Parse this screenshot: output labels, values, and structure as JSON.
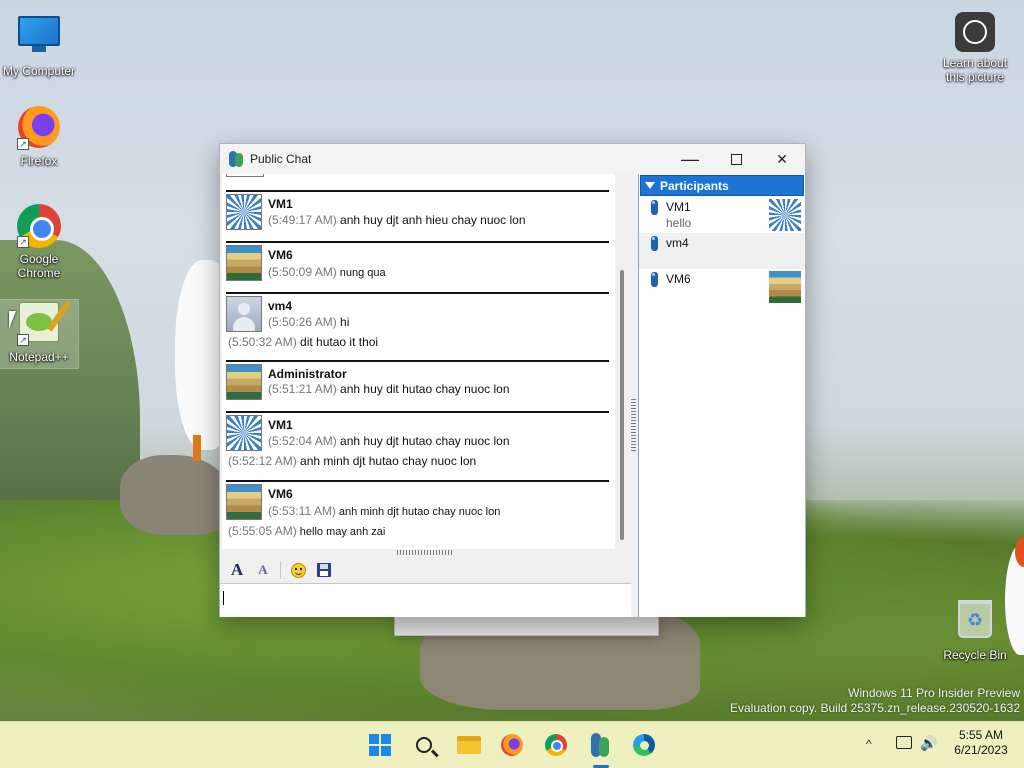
{
  "desktop": {
    "icons": [
      {
        "label": "My Computer",
        "icon": "computer-icon"
      },
      {
        "label": "Firefox",
        "icon": "firefox-icon"
      },
      {
        "label": "Google Chrome",
        "icon": "chrome-icon"
      },
      {
        "label": "Notepad++",
        "icon": "notepad-plus-plus-icon"
      },
      {
        "label": "Recycle Bin",
        "icon": "recycle-bin-icon"
      },
      {
        "label": "Learn about this picture",
        "icon": "learn-picture-icon"
      }
    ],
    "watermark": {
      "line1": "Windows 11 Pro Insider Preview",
      "line2": "Evaluation copy. Build 25375.zn_release.230520-1632"
    }
  },
  "window": {
    "title": "Public Chat",
    "controls": {
      "minimize": "—",
      "close": "✕"
    },
    "messages": [
      {
        "sender": "VM1",
        "avatar": "pinwheel",
        "lines": [
          {
            "time": "(5:49:17 AM)",
            "text": "anh huy djt anh hieu chay nuoc lon"
          }
        ]
      },
      {
        "sender": "VM6",
        "avatar": "stairs",
        "lines": [
          {
            "time": "(5:50:09 AM)",
            "text": "nung qua"
          }
        ]
      },
      {
        "sender": "vm4",
        "avatar": "default-person",
        "lines": [
          {
            "time": "(5:50:26 AM)",
            "text": "hi"
          },
          {
            "time": "(5:50:32 AM)",
            "text": "dit hutao it thoi"
          }
        ]
      },
      {
        "sender": "Administrator",
        "avatar": "stairs",
        "lines": [
          {
            "time": "(5:51:21 AM)",
            "text": "anh huy dit hutao chay nuoc lon"
          }
        ]
      },
      {
        "sender": "VM1",
        "avatar": "pinwheel",
        "lines": [
          {
            "time": "(5:52:04 AM)",
            "text": "anh huy djt hutao chay nuoc lon"
          },
          {
            "time": "(5:52:12 AM)",
            "text": "anh minh djt hutao chay nuoc lon"
          }
        ]
      },
      {
        "sender": "VM6",
        "avatar": "stairs",
        "lines": [
          {
            "time": "(5:53:11 AM)",
            "text": "anh minh djt hutao chay nuoc lon"
          },
          {
            "time": "(5:55:05 AM)",
            "text": "hello may anh zai"
          }
        ]
      }
    ],
    "toolbar": {
      "font_glyph": "A",
      "font_color_glyph": "A",
      "items": [
        "font-icon",
        "font-color-icon",
        "smiley-icon",
        "save-icon"
      ]
    },
    "input": {
      "value": ""
    },
    "participants": {
      "header": "Participants",
      "items": [
        {
          "name": "VM1",
          "status": "hello",
          "avatar": "pinwheel"
        },
        {
          "name": "vm4",
          "status": "",
          "avatar": ""
        },
        {
          "name": "VM6",
          "status": "",
          "avatar": "stairs"
        }
      ]
    }
  },
  "taskbar": {
    "apps": [
      "start-icon",
      "search-icon",
      "file-explorer-icon",
      "firefox-icon",
      "chrome-icon",
      "chat-app-icon",
      "edge-icon"
    ],
    "tray": {
      "chevron": "^",
      "volume": "🔊"
    },
    "clock": {
      "time": "5:55 AM",
      "date": "6/21/2023"
    }
  }
}
